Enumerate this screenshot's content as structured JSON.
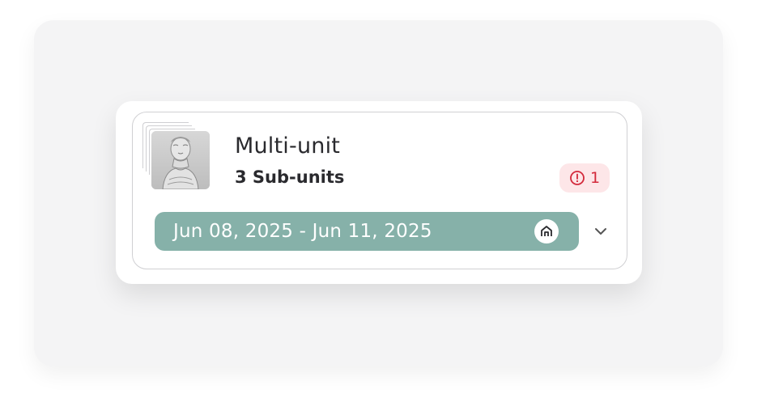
{
  "card": {
    "title": "Multi-unit",
    "subtitle": "3 Sub-units",
    "alert": {
      "count": "1",
      "icon": "alert-circle-icon",
      "color": "#d3293b",
      "background": "#fde6e8"
    },
    "date_range": {
      "label": "Jun 08, 2025 - Jun 11, 2025",
      "background": "#86b1a9",
      "icon": "home-unit-icon"
    },
    "expand_icon": "chevron-down-icon",
    "thumbnail_icon": "statue-thumbnail"
  }
}
